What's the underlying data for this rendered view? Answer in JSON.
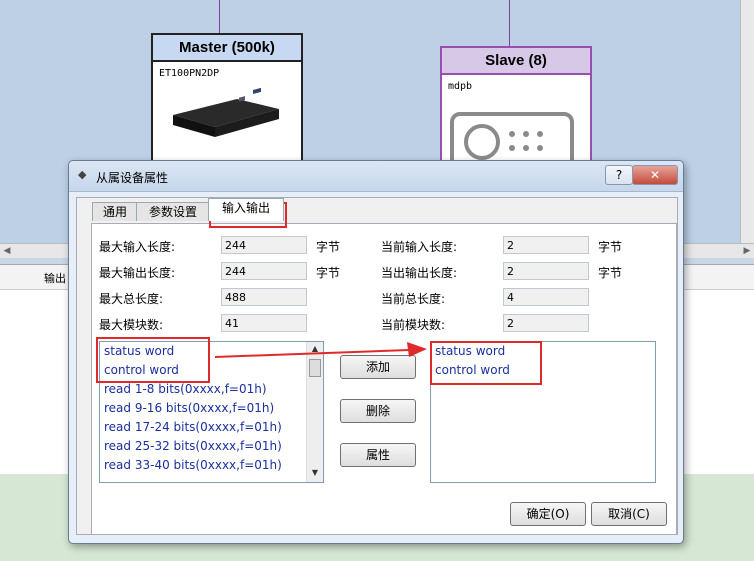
{
  "background": {
    "master": {
      "title": "Master (500k)",
      "model": "ET100PN2DP"
    },
    "slave": {
      "title": "Slave (8)",
      "model": "mdpb"
    },
    "lower_panel_column": "输出"
  },
  "dialog": {
    "title": "从属设备属性",
    "help_label": "?",
    "close_label": "✕",
    "tabs": [
      "通用",
      "参数设置",
      "输入输出"
    ],
    "active_tab": "输入输出",
    "fields_left": [
      {
        "label": "最大输入长度:",
        "value": "244",
        "unit": "字节"
      },
      {
        "label": "最大输出长度:",
        "value": "244",
        "unit": "字节"
      },
      {
        "label": "最大总长度:",
        "value": "488",
        "unit": ""
      },
      {
        "label": "最大模块数:",
        "value": "41",
        "unit": ""
      }
    ],
    "fields_right": [
      {
        "label": "当前输入长度:",
        "value": "2",
        "unit": "字节"
      },
      {
        "label": "当出输出长度:",
        "value": "2",
        "unit": "字节"
      },
      {
        "label": "当前总长度:",
        "value": "4",
        "unit": ""
      },
      {
        "label": "当前模块数:",
        "value": "2",
        "unit": ""
      }
    ],
    "available_modules": [
      "status word",
      "control word",
      "read 1-8 bits(0xxxx,f=01h)",
      "read 9-16 bits(0xxxx,f=01h)",
      "read 17-24 bits(0xxxx,f=01h)",
      "read 25-32 bits(0xxxx,f=01h)",
      "read 33-40 bits(0xxxx,f=01h)"
    ],
    "selected_modules": [
      "status word",
      "control word"
    ],
    "buttons": {
      "add": "添加",
      "delete": "删除",
      "properties": "属性",
      "ok": "确定(O)",
      "cancel": "取消(C)"
    },
    "colors": {
      "highlight": "#e02a2a",
      "list_text": "#1a2fa0"
    }
  }
}
